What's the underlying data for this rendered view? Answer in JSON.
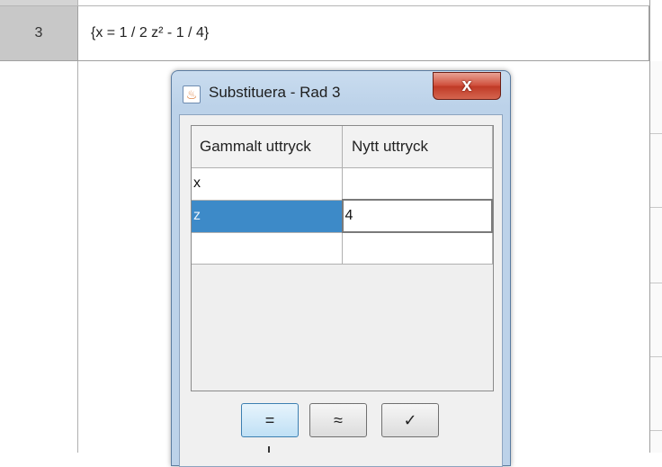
{
  "sheet": {
    "row_number": "3",
    "row_expression": "{x = 1 / 2 z² - 1 / 4}"
  },
  "dialog": {
    "title": "Substituera - Rad 3",
    "close_label": "x",
    "app_icon": "java-coffee-icon",
    "table": {
      "headers": [
        "Gammalt uttryck",
        "Nytt uttryck"
      ],
      "rows": [
        {
          "old": "x",
          "new": ""
        },
        {
          "old": "z",
          "new": "4"
        },
        {
          "old": "",
          "new": ""
        }
      ],
      "selected_row": 1
    },
    "buttons": {
      "substitute": "=",
      "numeric": "≈",
      "keep_input": "✓"
    }
  },
  "colors": {
    "selection": "#3d8ac8",
    "close_button": "#c8422e",
    "dialog_frame": "#bcd2e9"
  }
}
